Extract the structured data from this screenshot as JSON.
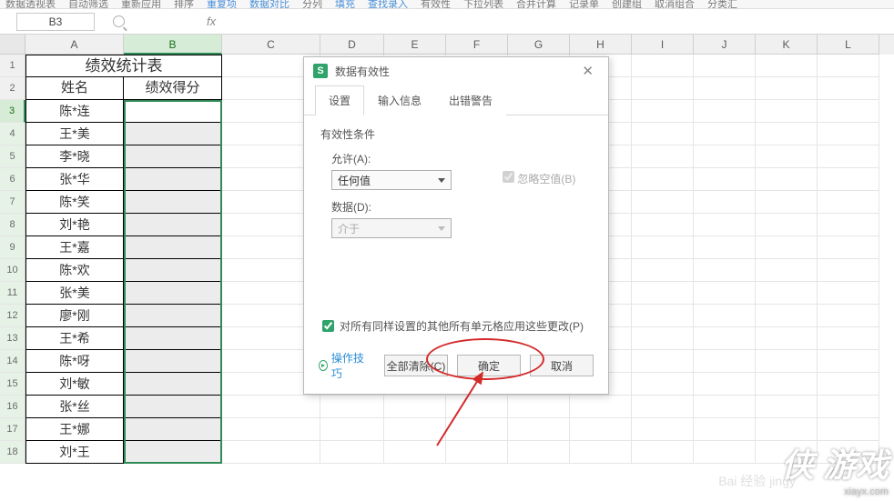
{
  "toolbar": {
    "items": [
      "数据透视表",
      "自动筛选",
      "重新应用",
      "排序",
      "重复项",
      "数据对比",
      "分列",
      "填充",
      "查找录入",
      "有效性",
      "下拉列表",
      "合并计算",
      "记录单",
      "创建组",
      "取消组合",
      "分类汇"
    ]
  },
  "name_box": "B3",
  "columns": [
    "A",
    "B",
    "C",
    "D",
    "E",
    "F",
    "G",
    "H",
    "I",
    "J",
    "K",
    "L"
  ],
  "rows_count": 18,
  "table": {
    "title": "绩效统计表",
    "headers": [
      "姓名",
      "绩效得分"
    ],
    "names": [
      "陈*连",
      "王*美",
      "李*晓",
      "张*华",
      "陈*笑",
      "刘*艳",
      "王*嘉",
      "陈*欢",
      "张*美",
      "廖*刚",
      "王*希",
      "陈*呀",
      "刘*敏",
      "张*丝",
      "王*娜",
      "刘*王"
    ]
  },
  "dialog": {
    "title": "数据有效性",
    "tabs": [
      "设置",
      "输入信息",
      "出错警告"
    ],
    "section": "有效性条件",
    "allow_label": "允许(A):",
    "allow_value": "任何值",
    "data_label": "数据(D):",
    "data_value": "介于",
    "ignore_blank": "忽略空值(B)",
    "apply_others": "对所有同样设置的其他所有单元格应用这些更改(P)",
    "tips_link": "操作技巧",
    "clear_btn": "全部清除(C)",
    "ok_btn": "确定",
    "cancel_btn": "取消"
  },
  "watermark": {
    "logo": "侠 游戏",
    "site": "xiayx.com",
    "other": "Bai 经验 jingy"
  }
}
